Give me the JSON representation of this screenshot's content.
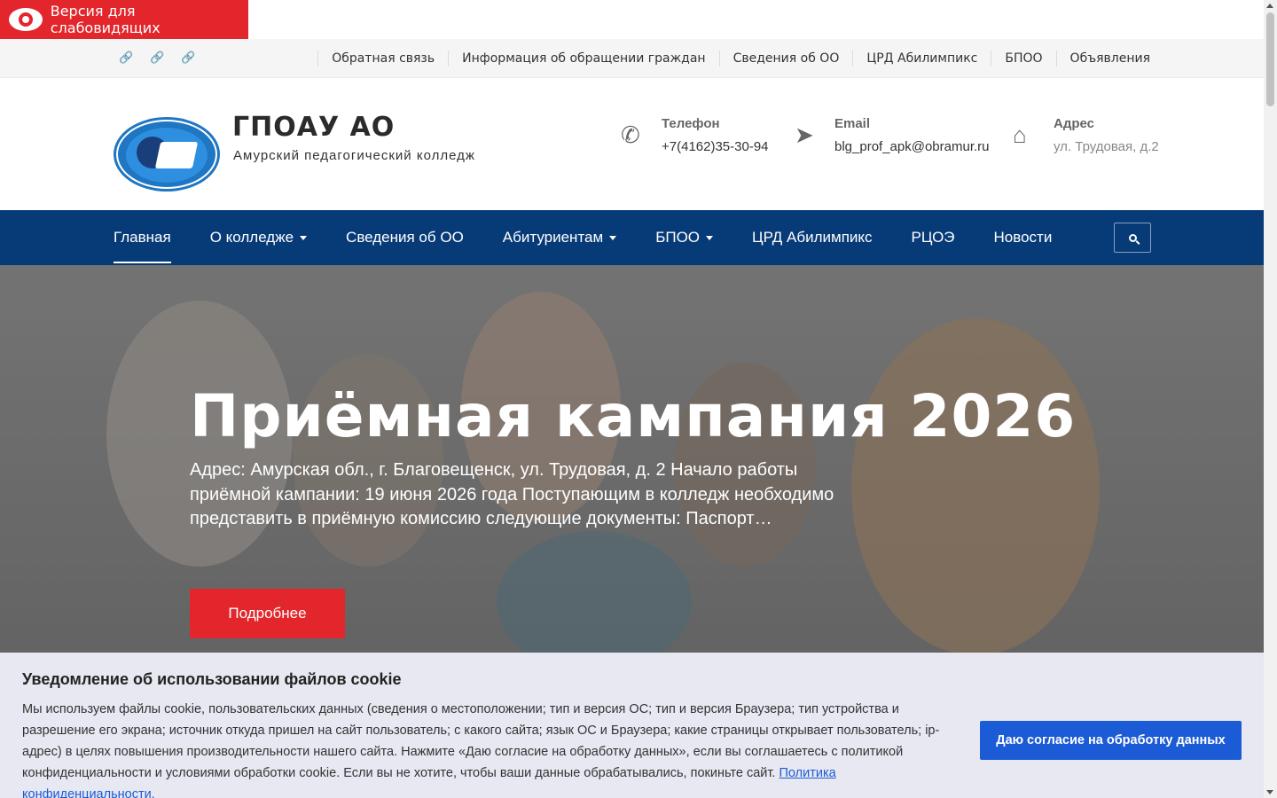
{
  "accessibility": {
    "label": "Версия для слабовидящих"
  },
  "topbar": {
    "social_icons": [
      "link-icon",
      "link-icon",
      "link-icon"
    ],
    "links": [
      "Обратная связь",
      "Информация об обращении граждан",
      "Сведения об ОО",
      "ЦРД Абилимпикс",
      "БПОО",
      "Объявления"
    ]
  },
  "header": {
    "title": "ГПОАУ АО",
    "subtitle": "Амурский педагогический колледж",
    "contacts": {
      "phone": {
        "title": "Телефон",
        "value": "+7(4162)35-30-94",
        "icon": "phone-icon"
      },
      "email": {
        "title": "Email",
        "value": "blg_prof_apk@obramur.ru",
        "icon": "paper-plane-icon"
      },
      "address": {
        "title": "Адрес",
        "value": "ул. Трудовая, д.2",
        "icon": "home-icon"
      }
    }
  },
  "nav": {
    "items": [
      {
        "label": "Главная",
        "dropdown": false,
        "active": true
      },
      {
        "label": "О колледже",
        "dropdown": true,
        "active": false
      },
      {
        "label": "Сведения об ОО",
        "dropdown": false,
        "active": false
      },
      {
        "label": "Абитуриентам",
        "dropdown": true,
        "active": false
      },
      {
        "label": "БПОО",
        "dropdown": true,
        "active": false
      },
      {
        "label": "ЦРД Абилимпикс",
        "dropdown": false,
        "active": false
      },
      {
        "label": "РЦОЭ",
        "dropdown": false,
        "active": false
      },
      {
        "label": "Новости",
        "dropdown": false,
        "active": false
      }
    ],
    "search_icon": "search-icon"
  },
  "hero": {
    "title": "Приёмная кампания 2026",
    "text": "  Адрес: Амурская обл., г. Благовещенск, ул. Трудовая, д. 2 Начало работы приёмной кампании: 19 июня 2026 года     Поступающим в колледж необходимо представить в приёмную комиссию следующие документы: Паспорт…",
    "button": "Подробнее"
  },
  "cookie": {
    "title": "Уведомление об использовании файлов cookie",
    "text": "Мы используем файлы cookie, пользовательских данных (сведения о местоположении; тип и версия ОС; тип и версия Браузера; тип устройства и разрешение его экрана; источник откуда пришел на сайт пользователь; с какого сайта; язык ОС и Браузера; какие страницы открывает пользователь; ip-адрес) в целях повышения производительности нашего сайта. Нажмите «Даю согласие на обработку данных», если вы соглашаетесь с политикой конфиденциальности и условиями обработки cookie. Если вы не хотите, чтобы ваши данные обрабатывались, покиньте сайт.",
    "link": "Политика конфиденциальности.",
    "button": "Даю согласие на обработку данных"
  },
  "colors": {
    "accent_red": "#e3262b",
    "nav_blue": "#073b78",
    "cookie_blue": "#1c5bd6"
  }
}
